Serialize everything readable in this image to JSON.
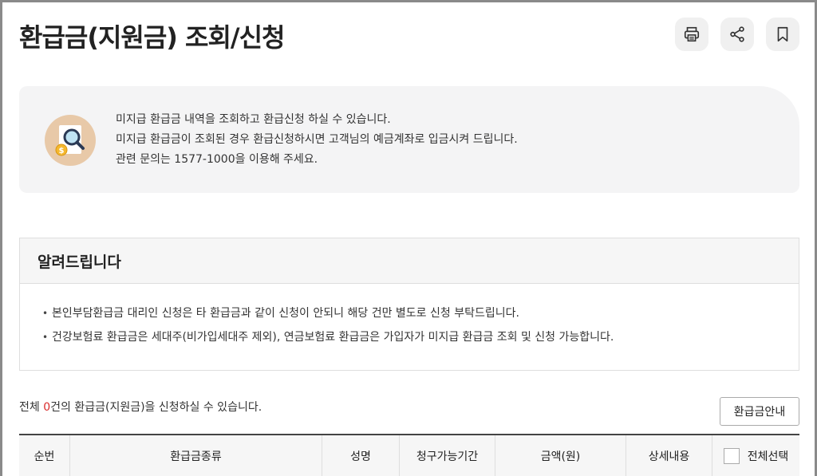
{
  "page": {
    "title": "환급금(지원금) 조회/신청"
  },
  "toolbar": {
    "print_icon": "printer-icon",
    "share_icon": "share-icon",
    "bookmark_icon": "bookmark-icon"
  },
  "info": {
    "icon": "magnifier-coin-icon",
    "lines": [
      "미지급 환급금 내역을 조회하고 환급신청 하실 수 있습니다.",
      "미지급 환급금이 조회된 경우 환급신청하시면 고객님의 예금계좌로 입금시켜 드립니다.",
      "관련 문의는 1577-1000을 이용해 주세요."
    ]
  },
  "notice": {
    "title": "알려드립니다",
    "items": [
      "본인부담환급금 대리인 신청은 타 환급금과 같이 신청이 안되니 해당 건만 별도로 신청 부탁드립니다.",
      "건강보험료 환급금은 세대주(비가입세대주 제외), 연금보험료 환급금은 가입자가 미지급 환급금 조회 및 신청 가능합니다."
    ]
  },
  "summary": {
    "prefix": "전체 ",
    "count": "0",
    "suffix": "건의 환급금(지원금)을 신청하실 수 있습니다."
  },
  "guide_button": "환급금안내",
  "table": {
    "headers": [
      "순번",
      "환급금종류",
      "성명",
      "청구가능기간",
      "금액(원)",
      "상세내용",
      "전체선택"
    ]
  },
  "colors": {
    "accent_count": "#d92c2c",
    "info_bg": "#f4f4f5",
    "icon_circle": "#e8c9a8"
  }
}
